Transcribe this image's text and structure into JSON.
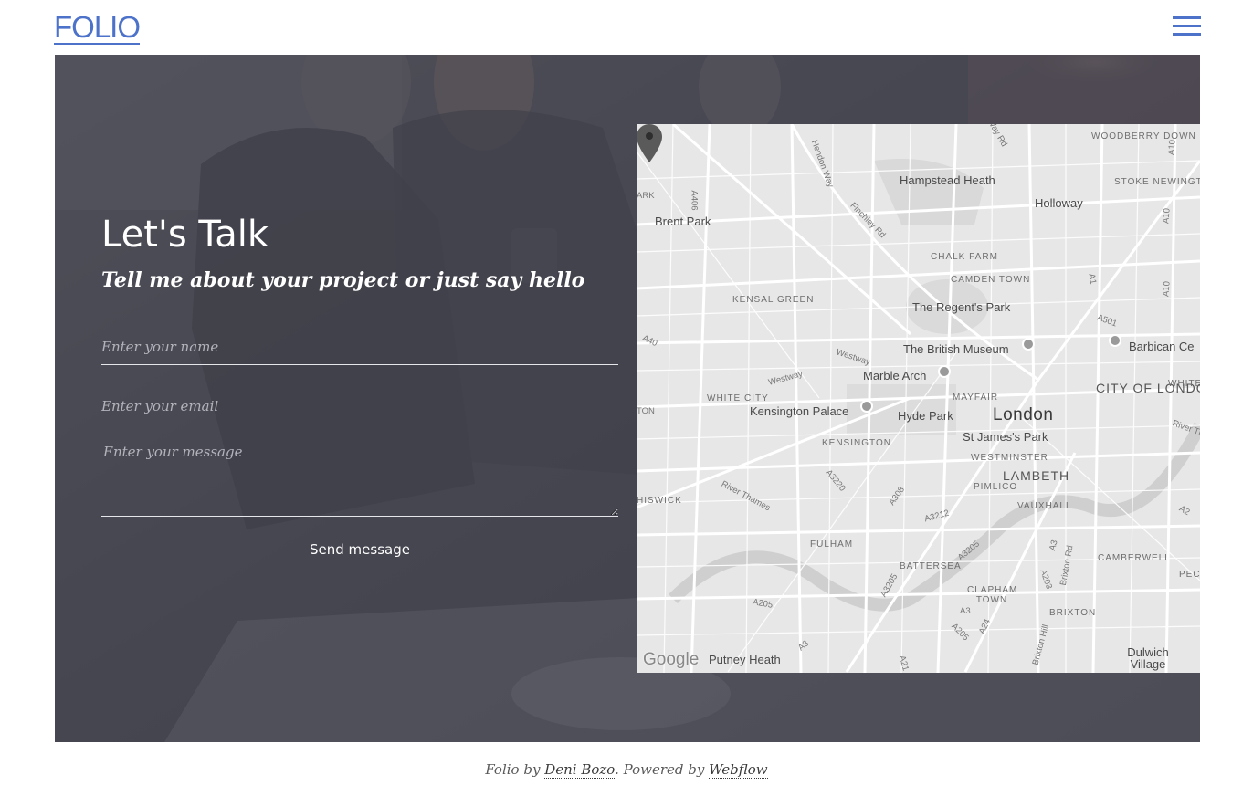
{
  "header": {
    "logo": "FOLIO"
  },
  "contact": {
    "title": "Let's Talk",
    "subtitle": "Tell me about your project or just say hello",
    "name_placeholder": "Enter your name",
    "email_placeholder": "Enter your email",
    "message_placeholder": "Enter your message",
    "send_label": "Send message"
  },
  "map": {
    "google_label": "Google",
    "labels": {
      "woodberry_down": "WOODBERRY DOWN",
      "hampstead_heath": "Hampstead Heath",
      "holloway": "Holloway",
      "stoke_newington": "STOKE NEWINGTON",
      "brent_park": "Brent Park",
      "chalk_farm": "CHALK FARM",
      "camden_town": "CAMDEN TOWN",
      "kensal_green": "KENSAL GREEN",
      "regents_park": "The Regent's Park",
      "british_museum": "The British Museum",
      "barbican": "Barbican Ce",
      "marble_arch": "Marble Arch",
      "city_of_london": "CITY OF LONDON",
      "whitechapel": "WHITECH",
      "white_city": "WHITE CITY",
      "mayfair": "MAYFAIR",
      "kensington_palace": "Kensington Palace",
      "hyde_park": "Hyde Park",
      "london": "London",
      "st_james_park": "St James's Park",
      "kensington": "KENSINGTON",
      "westminster": "WESTMINSTER",
      "lambeth": "LAMBETH",
      "pimlico": "PIMLICO",
      "vauxhall": "VAUXHALL",
      "chiswick": "HISWICK",
      "river_thames": "River Thames",
      "river_t": "River Th",
      "fulham": "FULHAM",
      "camberwell": "CAMBERWELL",
      "peckham": "PECKHA",
      "battersea": "BATTERSEA",
      "clapham_town": "CLAPHAM TOWN",
      "brixton": "BRIXTON",
      "putney_heath": "Putney Heath",
      "dulwich_village": "Dulwich Village",
      "hendon_way": "Hendon Way",
      "finchley_rd": "Finchley Rd",
      "westway": "Westway",
      "westway2": "Westway",
      "a406": "A406",
      "a40": "A40",
      "a1": "A1",
      "a10": "A10",
      "a10b": "A10",
      "a501": "A501",
      "a3220": "A3220",
      "a308": "A308",
      "a3212": "A3212",
      "a3205": "A3205",
      "a3205b": "A3205",
      "a3": "A3",
      "a3b": "A3",
      "a3c": "A3",
      "a203": "A203",
      "a205": "A205",
      "a205b": "A205",
      "a24": "A24",
      "a2": "A2",
      "brixton_rd": "Brixton Rd",
      "brixton_hill": "Brixton Hill",
      "park": "ARK",
      "ton": "TON",
      "a10c": "A10",
      "a21": "A21",
      "way_rd": "Way Rd"
    }
  },
  "footer": {
    "prefix": "Folio by ",
    "author": "Deni Bozo",
    "middle": ". Powered by ",
    "platform": "Webflow"
  },
  "colors": {
    "accent": "#4d72c9",
    "overlay": "#464652",
    "map_bg": "#e6e6e6",
    "map_road": "#ffffff",
    "map_water": "#cfcfcf"
  }
}
